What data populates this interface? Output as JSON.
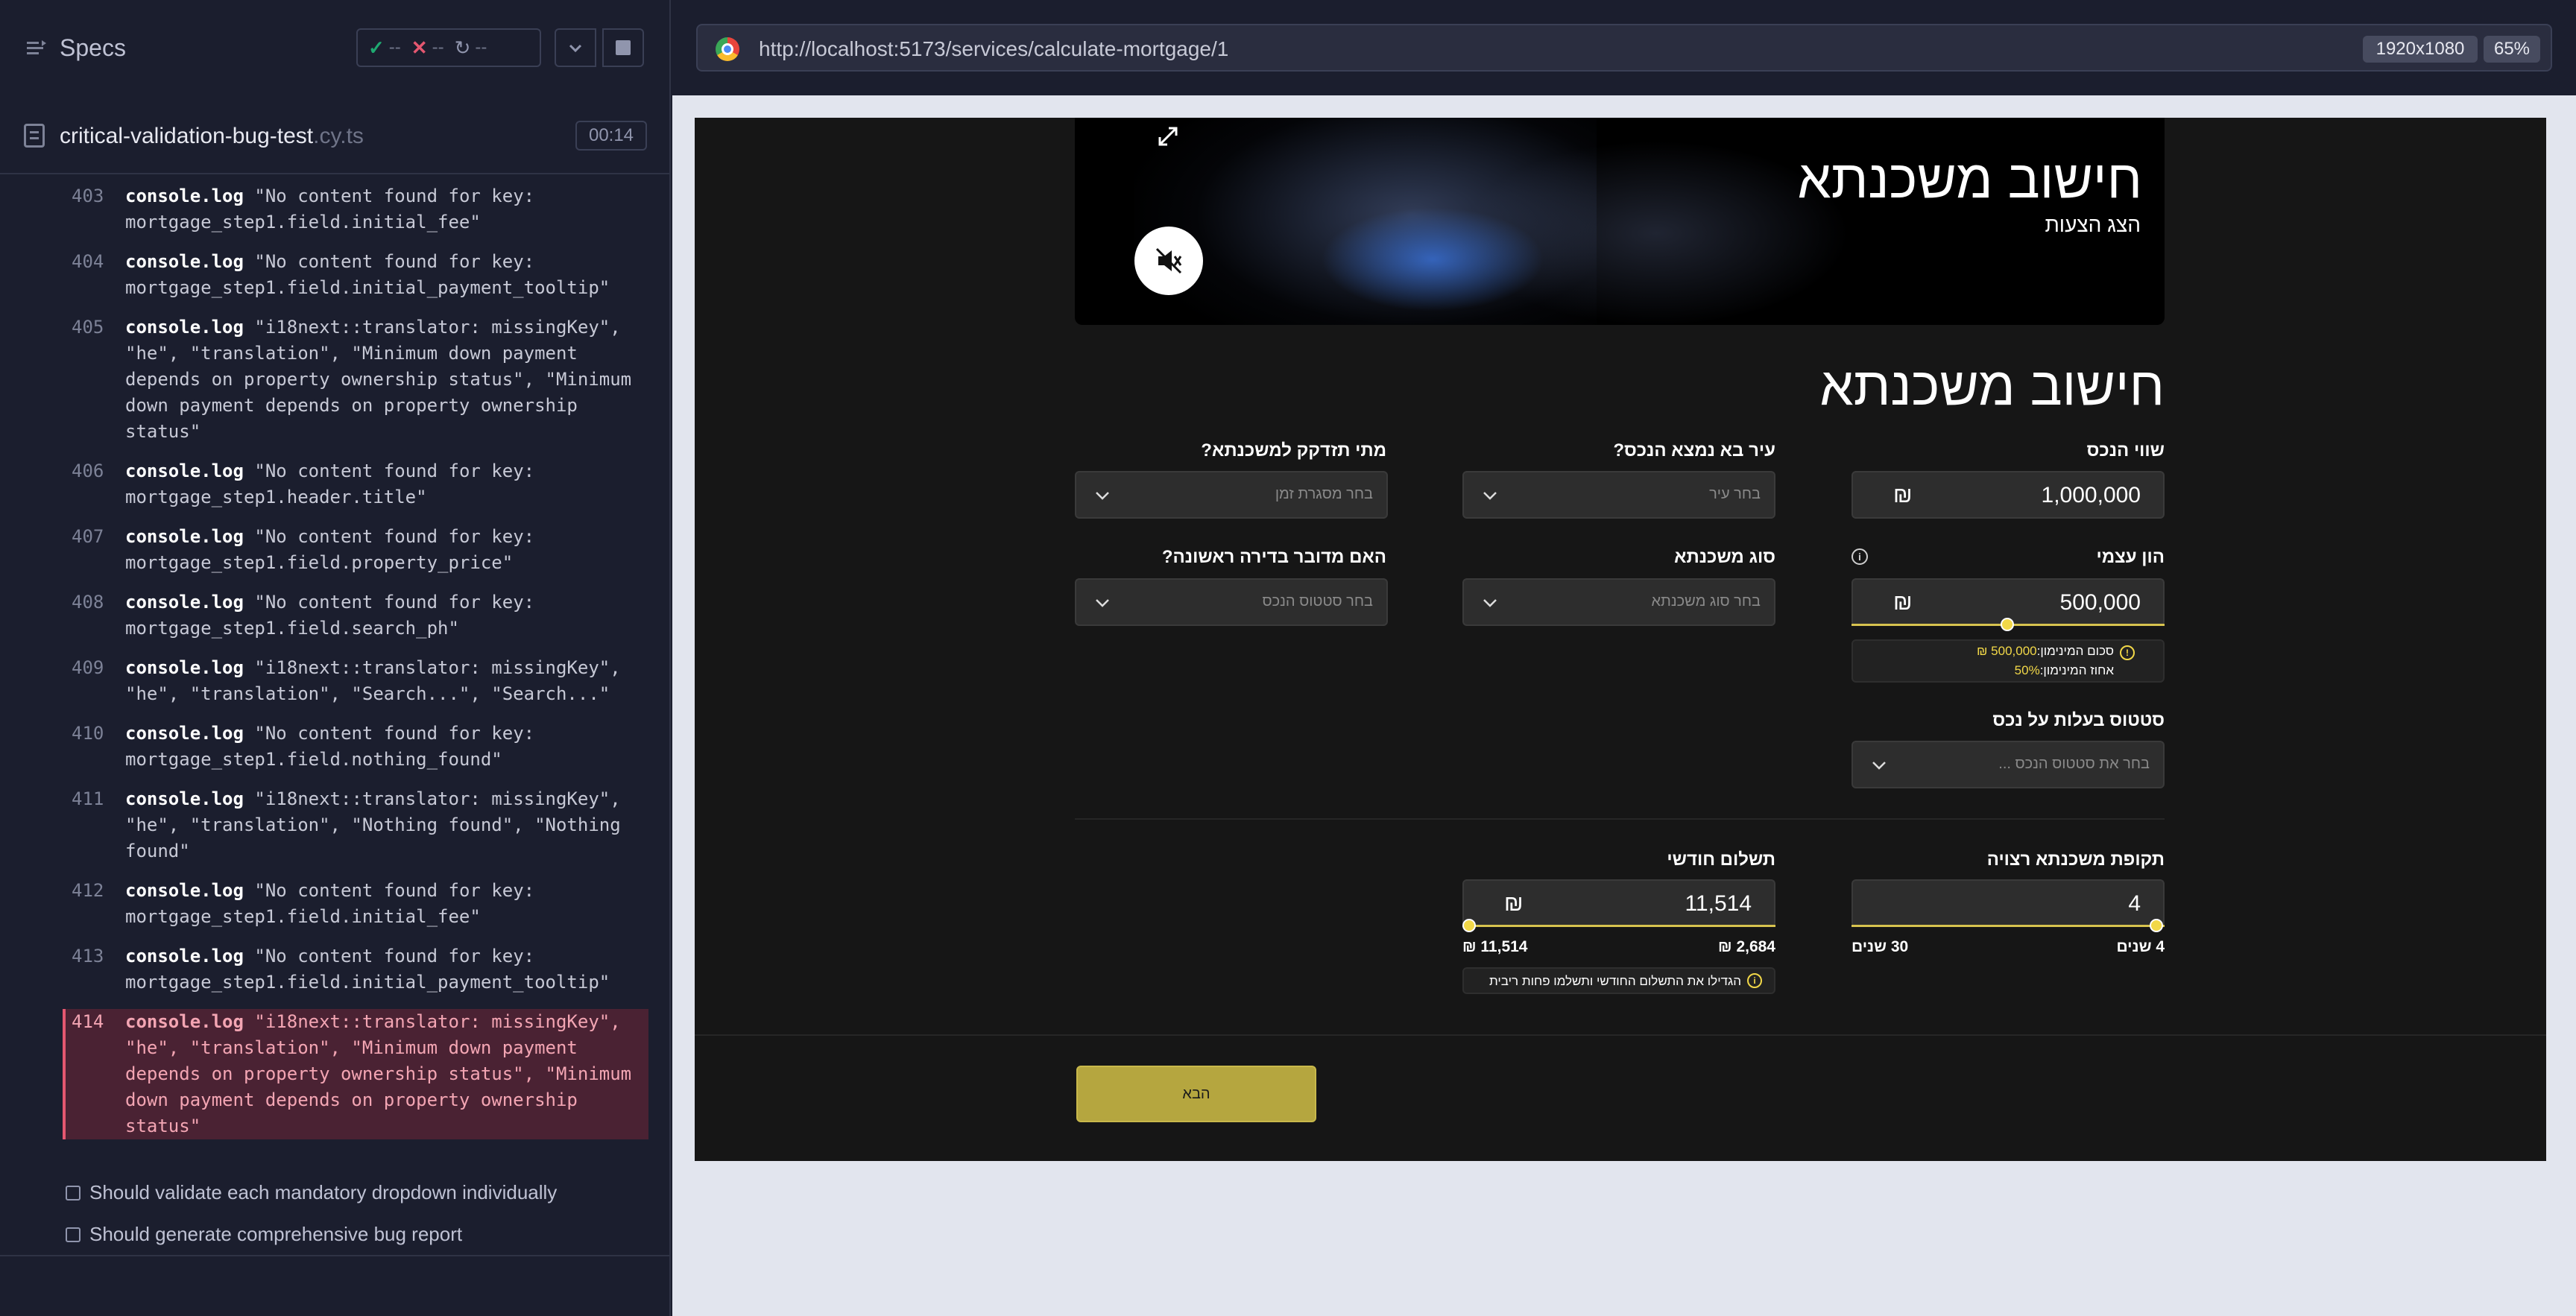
{
  "runner": {
    "specs_label": "Specs",
    "passed": "--",
    "failed": "--",
    "pending": "--",
    "spec_name": "critical-validation-bug-test",
    "spec_ext": ".cy.ts",
    "timer": "00:14",
    "log": [
      {
        "num": "403",
        "cmd": "console.log",
        "msg": "\"No content found for key: mortgage_step1.field.initial_fee\""
      },
      {
        "num": "404",
        "cmd": "console.log",
        "msg": "\"No content found for key: mortgage_step1.field.initial_payment_tooltip\""
      },
      {
        "num": "405",
        "cmd": "console.log",
        "msg": "\"i18next::translator: missingKey\", \"he\", \"translation\", \"Minimum down payment depends on property ownership status\", \"Minimum down payment depends on property ownership status\""
      },
      {
        "num": "406",
        "cmd": "console.log",
        "msg": "\"No content found for key: mortgage_step1.header.title\""
      },
      {
        "num": "407",
        "cmd": "console.log",
        "msg": "\"No content found for key: mortgage_step1.field.property_price\""
      },
      {
        "num": "408",
        "cmd": "console.log",
        "msg": "\"No content found for key: mortgage_step1.field.search_ph\""
      },
      {
        "num": "409",
        "cmd": "console.log",
        "msg": "\"i18next::translator: missingKey\", \"he\", \"translation\", \"Search...\", \"Search...\""
      },
      {
        "num": "410",
        "cmd": "console.log",
        "msg": "\"No content found for key: mortgage_step1.field.nothing_found\""
      },
      {
        "num": "411",
        "cmd": "console.log",
        "msg": "\"i18next::translator: missingKey\", \"he\", \"translation\", \"Nothing found\", \"Nothing found\""
      },
      {
        "num": "412",
        "cmd": "console.log",
        "msg": "\"No content found for key: mortgage_step1.field.initial_fee\""
      },
      {
        "num": "413",
        "cmd": "console.log",
        "msg": "\"No content found for key: mortgage_step1.field.initial_payment_tooltip\""
      },
      {
        "num": "414",
        "cmd": "console.log",
        "msg": "\"i18next::translator: missingKey\", \"he\", \"translation\", \"Minimum down payment depends on property ownership status\", \"Minimum down payment depends on property ownership status\""
      }
    ],
    "tests": [
      "Should validate each mandatory dropdown individually",
      "Should generate comprehensive bug report"
    ]
  },
  "browser": {
    "url": "http://localhost:5173/services/calculate-mortgage/1",
    "resolution": "1920x1080",
    "zoom": "65%"
  },
  "app": {
    "hero_title": "חישוב משכנתא",
    "hero_subtitle": "הצג הצעות",
    "page_title": "חישוב משכנתא",
    "property_value": {
      "label": "שווי הנכס",
      "value": "1,000,000",
      "currency": "₪"
    },
    "city": {
      "label": "עיר בא נמצא הנכס?",
      "placeholder": "בחר עיר"
    },
    "when_needed": {
      "label": "מתי תזדקק למשכנתא?",
      "placeholder": "בחר מסגרת זמן"
    },
    "equity": {
      "label": "הון עצמי",
      "value": "500,000",
      "currency": "₪",
      "level": 0.5
    },
    "equity_note": {
      "min_sum_label": "סכום המינימון:",
      "min_sum_value": "500,000 ₪",
      "min_pct_label": "אחוז המינימון:",
      "min_pct_value": "50%"
    },
    "mortgage_type": {
      "label": "סוג משכנתא",
      "placeholder": "בחר סוג משכנתא"
    },
    "first_home": {
      "label": "האם מדובר בדירה ראשונה?",
      "placeholder": "בחר סטטוס הנכס"
    },
    "ownership": {
      "label": "סטטוס בעלות על נכס",
      "placeholder": "בחר את סטטוס הנכס ..."
    },
    "period": {
      "label": "תקופת משכנתא רצויה",
      "value": "4",
      "min_label": "4 שנים",
      "max_label": "30 שנים",
      "level": 0.0
    },
    "monthly": {
      "label": "תשלום חודשי",
      "value": "11,514",
      "currency": "₪",
      "min_label": "2,684 ₪",
      "max_label": "11,514 ₪",
      "level": 1.0
    },
    "monthly_tip": "הגדילו את התשלום החודשי ותשלמו פחות ריבית",
    "next_label": "הבא"
  }
}
